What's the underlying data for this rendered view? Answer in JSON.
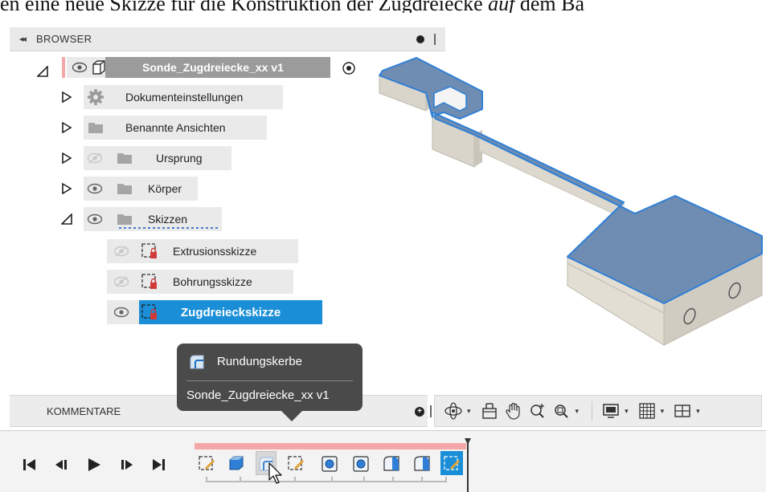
{
  "doc_caption": {
    "part1": "en eine neue Skizze für die Konstruktion der Zugdreiecke ",
    "part2": "auf",
    "part3": " dem Ba"
  },
  "browser": {
    "collapse_glyph": "◂◂",
    "title": "BROWSER",
    "root": {
      "label": "Sonde_Zugdreiecke_xx v1"
    },
    "items": [
      {
        "label": "Dokumenteinstellungen",
        "icon": "gear-icon"
      },
      {
        "label": "Benannte Ansichten",
        "icon": "folder-icon"
      },
      {
        "label": "Ursprung",
        "icon": "folder-icon",
        "visible": false
      },
      {
        "label": "Körper",
        "icon": "folder-icon",
        "visible": true
      },
      {
        "label": "Skizzen",
        "icon": "folder-icon",
        "visible": true,
        "expanded": true
      }
    ],
    "sketches": [
      {
        "label": "Extrusionsskizze",
        "visible": false
      },
      {
        "label": "Bohrungsskizze",
        "visible": false
      },
      {
        "label": "Zugdreieckskizze",
        "visible": true,
        "selected": true
      }
    ]
  },
  "comments": {
    "label": "KOMMENTARE"
  },
  "tooltip": {
    "title": "Rundungskerbe",
    "subtitle": "Sonde_Zugdreiecke_xx v1"
  },
  "nav_toolbar": {
    "buttons": [
      "orbit-icon",
      "look-at-icon",
      "pan-icon",
      "zoom-icon",
      "fit-icon",
      "display-settings-icon",
      "grid-icon",
      "viewports-icon"
    ]
  },
  "timeline": {
    "controls": [
      "go-to-start",
      "step-back",
      "play",
      "step-forward",
      "go-to-end"
    ],
    "features": [
      "sketch",
      "extrude",
      "fillet-notch",
      "sketch",
      "hole",
      "hole",
      "fillet",
      "fillet",
      "sketch-active"
    ]
  },
  "colors": {
    "accent": "#1a8fd8",
    "model_face": "#6f8db2",
    "model_side": "#e2ded3",
    "timeline_band": "#f4a7a7",
    "tooltip_bg": "#4a4a4a"
  }
}
